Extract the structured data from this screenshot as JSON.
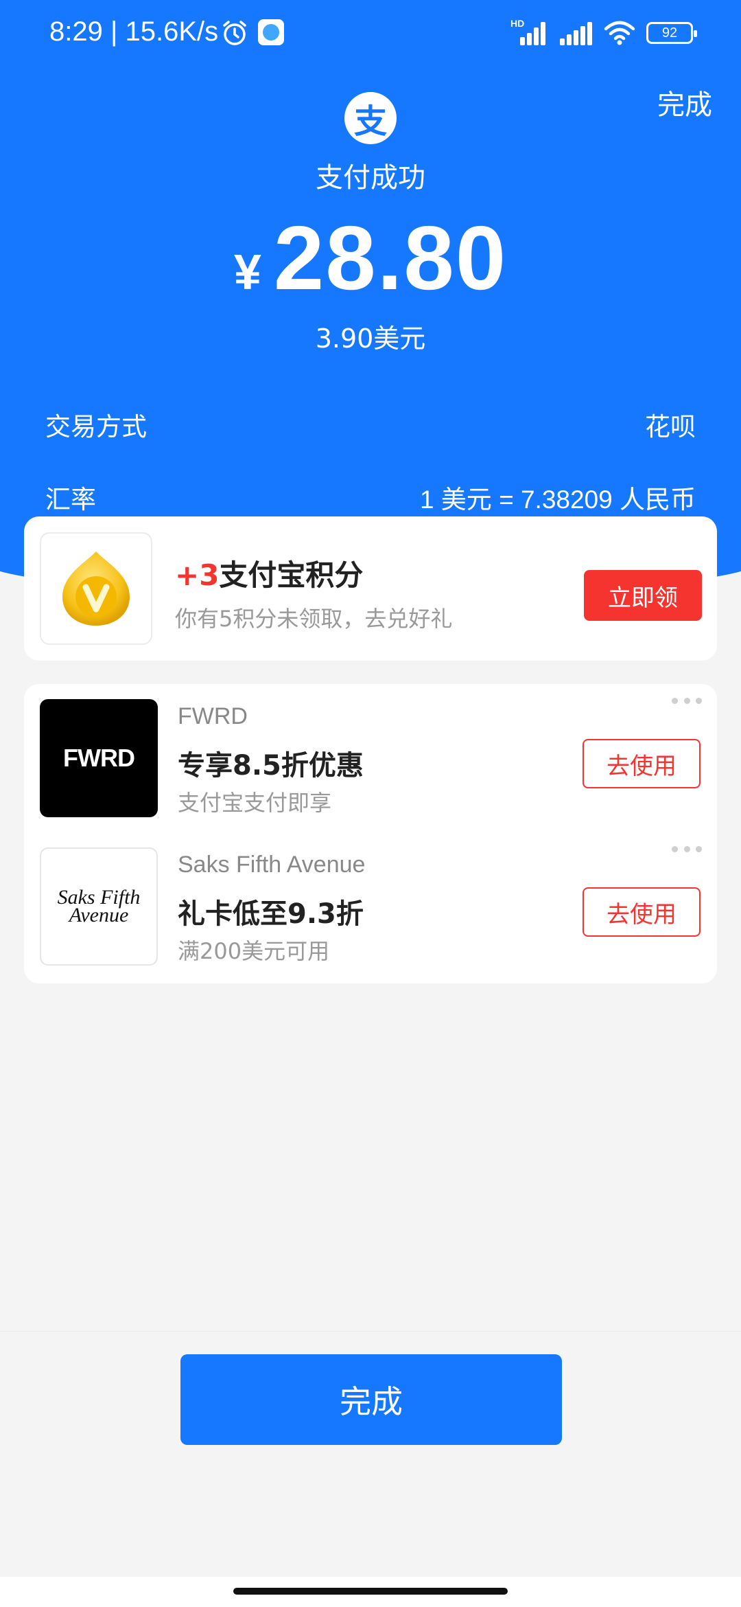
{
  "status_bar": {
    "time": "8:29 | 15.6K/s",
    "battery": "92",
    "hd_label": "HD"
  },
  "header": {
    "done_label": "完成",
    "logo_glyph": "支",
    "status": "支付成功",
    "currency_symbol": "¥",
    "amount": "28.80",
    "foreign_amount": "3.90美元"
  },
  "details": [
    {
      "label": "交易方式",
      "value": "花呗"
    },
    {
      "label": "汇率",
      "value": "1 美元 = 7.38209 人民币"
    }
  ],
  "points_card": {
    "plus": "+3",
    "title": "支付宝积分",
    "subtitle": "你有5积分未领取，去兑好礼",
    "button": "立即领"
  },
  "coupons": [
    {
      "logo_text": "FWRD",
      "brand": "FWRD",
      "title": "专享8.5折优惠",
      "subtitle": "支付宝支付即享",
      "button": "去使用"
    },
    {
      "logo_text": "Saks Fifth Avenue",
      "brand": "Saks Fifth Avenue",
      "title": "礼卡低至9.3折",
      "subtitle": "满200美元可用",
      "button": "去使用"
    }
  ],
  "footer": {
    "done_button": "完成"
  },
  "colors": {
    "primary": "#1677ff",
    "accent_red": "#f5342f",
    "background": "#f4f4f4"
  }
}
